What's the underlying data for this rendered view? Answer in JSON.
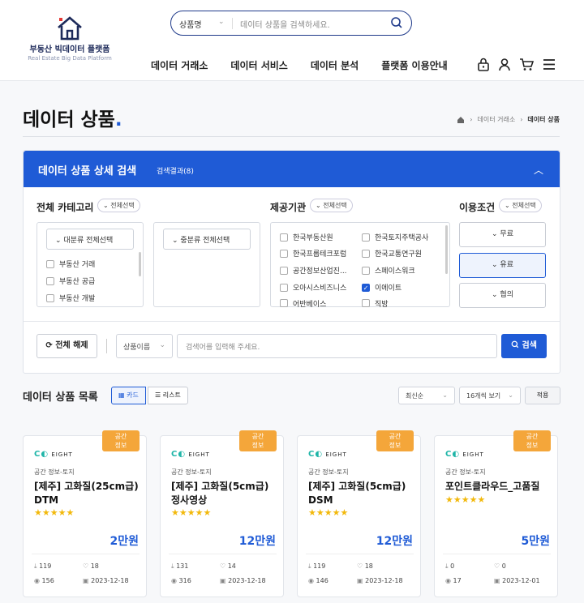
{
  "header": {
    "logo_name": "부동산 빅데이터 플랫폼",
    "logo_sub": "Real Estate Big Data Platform",
    "search_category": "상품명",
    "search_placeholder": "데이터 상품을 검색하세요.",
    "nav": [
      "데이터 거래소",
      "데이터 서비스",
      "데이터 분석",
      "플랫폼 이용안내"
    ],
    "icons": [
      "lock-icon",
      "user-icon",
      "cart-icon",
      "menu-icon"
    ]
  },
  "page": {
    "title": "데이터 상품",
    "breadcrumb": [
      "데이터 거래소",
      "데이터 상품"
    ]
  },
  "search_panel": {
    "title": "데이터 상품 상세 검색",
    "result_count": "검색결과(8)",
    "category_label": "전체 카테고리",
    "select_all": "전체선택",
    "major_select": "대분류 전체선택",
    "middle_select": "중분류 전체선택",
    "categories": [
      "부동산 거래",
      "부동산 공급",
      "부동산 개발"
    ],
    "provider_label": "제공기관",
    "providers": [
      {
        "name": "한국부동산원",
        "checked": false
      },
      {
        "name": "한국토지주택공사",
        "checked": false
      },
      {
        "name": "한국프롭테크포럼",
        "checked": false
      },
      {
        "name": "한국교통연구원",
        "checked": false
      },
      {
        "name": "공간정보산업진...",
        "checked": false
      },
      {
        "name": "스페이스워크",
        "checked": false
      },
      {
        "name": "오아시스비즈니스",
        "checked": false
      },
      {
        "name": "이에이트",
        "checked": true
      },
      {
        "name": "어반베이스",
        "checked": false
      },
      {
        "name": "직방",
        "checked": false
      }
    ],
    "terms_label": "이용조건",
    "terms": [
      {
        "label": "무료",
        "checked": false
      },
      {
        "label": "유료",
        "checked": true
      },
      {
        "label": "협의",
        "checked": false
      }
    ],
    "reset": "전체 해제",
    "field_select": "상품이름",
    "keyword_placeholder": "검색어를 입력해 주세요.",
    "search_button": "검색"
  },
  "list": {
    "title": "데이터 상품 목록",
    "view_card": "카드",
    "view_list": "리스트",
    "sort": "최신순",
    "per_page": "16개씩 보기",
    "apply": "적용"
  },
  "products": [
    {
      "badge": "공간\n정보",
      "brand": "EIGHT",
      "category": "공간 정보-토지",
      "name": "[제주] 고화질(25cm급) DTM",
      "rating": 5,
      "price": "2만원",
      "downloads": "119",
      "likes": "18",
      "views": "156",
      "date": "2023-12-18"
    },
    {
      "badge": "공간\n정보",
      "brand": "EIGHT",
      "category": "공간 정보-토지",
      "name": "[제주] 고화질(5cm급) 정사영상",
      "rating": 5,
      "price": "12만원",
      "downloads": "131",
      "likes": "14",
      "views": "316",
      "date": "2023-12-18"
    },
    {
      "badge": "공간\n정보",
      "brand": "EIGHT",
      "category": "공간 정보-토지",
      "name": "[제주] 고화질(5cm급) DSM",
      "rating": 5,
      "price": "12만원",
      "downloads": "119",
      "likes": "18",
      "views": "146",
      "date": "2023-12-18"
    },
    {
      "badge": "공간\n정보",
      "brand": "EIGHT",
      "category": "공간 정보-토지",
      "name": "포인트클라우드_고품질",
      "rating": 5,
      "price": "5만원",
      "downloads": "0",
      "likes": "0",
      "views": "17",
      "date": "2023-12-01"
    }
  ],
  "colors": {
    "primary": "#1f5bd6",
    "badge": "#f4a63a",
    "star": "#f2b90c"
  }
}
